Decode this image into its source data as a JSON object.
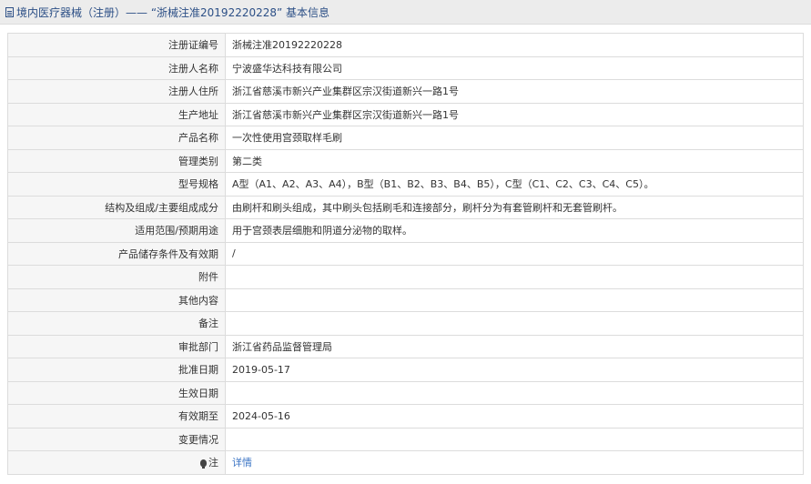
{
  "header": {
    "title": "境内医疗器械（注册）—— “浙械注准20192220228” 基本信息"
  },
  "rows": [
    {
      "label": "注册证编号",
      "value": "浙械注准20192220228"
    },
    {
      "label": "注册人名称",
      "value": "宁波盛华达科技有限公司"
    },
    {
      "label": "注册人住所",
      "value": "浙江省慈溪市新兴产业集群区宗汉街道新兴一路1号"
    },
    {
      "label": "生产地址",
      "value": "浙江省慈溪市新兴产业集群区宗汉街道新兴一路1号"
    },
    {
      "label": "产品名称",
      "value": "一次性使用宫颈取样毛刷"
    },
    {
      "label": "管理类别",
      "value": "第二类"
    },
    {
      "label": "型号规格",
      "value": "A型（A1、A2、A3、A4），B型（B1、B2、B3、B4、B5），C型（C1、C2、C3、C4、C5）。"
    },
    {
      "label": "结构及组成/主要组成成分",
      "value": "由刷杆和刷头组成，其中刷头包括刷毛和连接部分，刷杆分为有套管刷杆和无套管刷杆。"
    },
    {
      "label": "适用范围/预期用途",
      "value": "用于宫颈表层细胞和阴道分泌物的取样。"
    },
    {
      "label": "产品储存条件及有效期",
      "value": "/"
    },
    {
      "label": "附件",
      "value": ""
    },
    {
      "label": "其他内容",
      "value": ""
    },
    {
      "label": "备注",
      "value": ""
    },
    {
      "label": "审批部门",
      "value": "浙江省药品监督管理局"
    },
    {
      "label": "批准日期",
      "value": "2019-05-17"
    },
    {
      "label": "生效日期",
      "value": ""
    },
    {
      "label": "有效期至",
      "value": "2024-05-16"
    },
    {
      "label": "变更情况",
      "value": ""
    }
  ],
  "note": {
    "icon": "bulb-icon",
    "label": "注",
    "link_text": "详情",
    "link_color": "#3b74c4"
  }
}
